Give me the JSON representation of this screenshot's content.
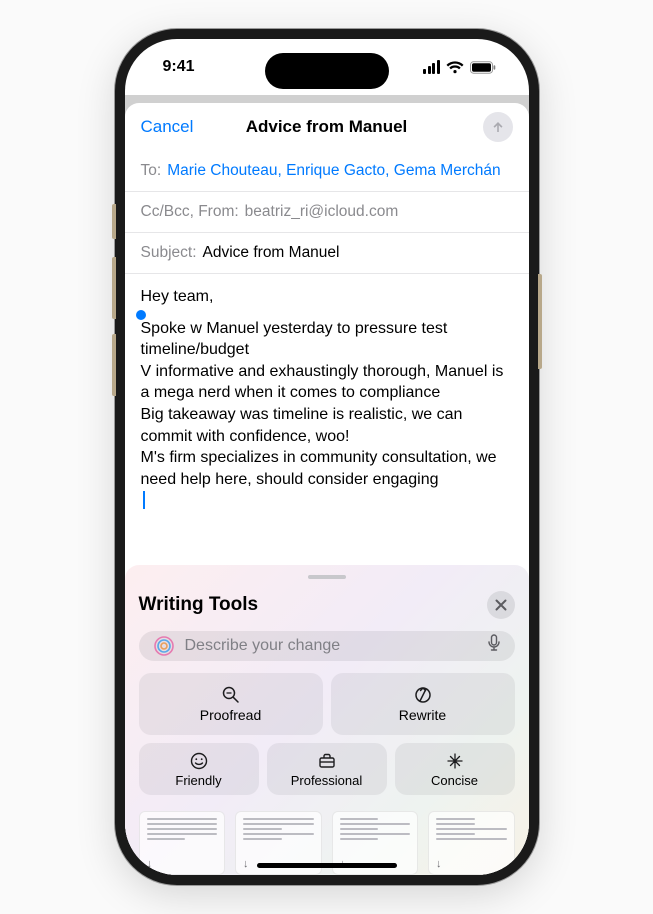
{
  "status": {
    "time": "9:41"
  },
  "nav": {
    "cancel": "Cancel",
    "title": "Advice from Manuel"
  },
  "fields": {
    "to_label": "To:",
    "recipients": "Marie Chouteau, Enrique Gacto, Gema Merchán",
    "cc_label": "Cc/Bcc, From:",
    "from_email": "beatriz_ri@icloud.com",
    "subject_label": "Subject:",
    "subject_value": "Advice from Manuel"
  },
  "body": {
    "greeting": "Hey team,",
    "selected_lines": [
      "Spoke w Manuel yesterday to pressure test timeline/budget",
      "V informative and exhaustingly thorough, Manuel is a mega nerd when it comes to compliance",
      "Big takeaway was timeline is realistic, we can commit with confidence, woo!",
      "M's firm specializes in community consultation, we need help here, should consider engaging"
    ]
  },
  "panel": {
    "title": "Writing Tools",
    "placeholder": "Describe your change",
    "actions": {
      "proofread": "Proofread",
      "rewrite": "Rewrite",
      "friendly": "Friendly",
      "professional": "Professional",
      "concise": "Concise"
    }
  }
}
